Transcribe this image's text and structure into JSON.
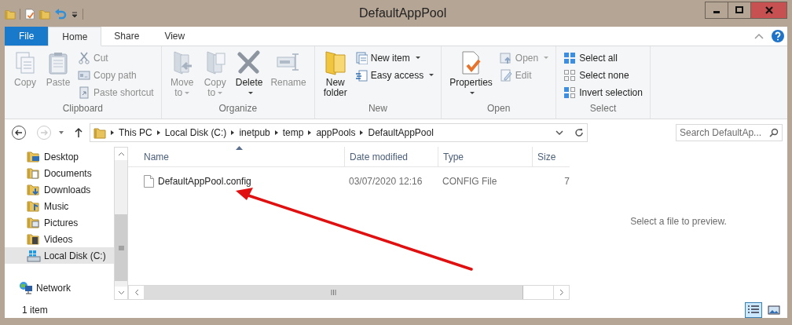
{
  "window": {
    "title": "DefaultAppPool"
  },
  "ribbon_tabs": [
    {
      "label": "File",
      "kind": "file",
      "selected": false
    },
    {
      "label": "Home",
      "kind": "tab",
      "selected": true
    },
    {
      "label": "Share",
      "kind": "tab",
      "selected": false
    },
    {
      "label": "View",
      "kind": "tab",
      "selected": false
    }
  ],
  "ribbon_groups": [
    {
      "label": "Clipboard",
      "items": [
        {
          "label": "Copy",
          "kind": "large",
          "disabled": true,
          "dropdown": false
        },
        {
          "label": "Paste",
          "kind": "large",
          "disabled": true,
          "dropdown": false
        },
        {
          "label": "Cut",
          "kind": "small",
          "disabled": true,
          "dropdown": false
        },
        {
          "label": "Copy path",
          "kind": "small",
          "disabled": true,
          "dropdown": false
        },
        {
          "label": "Paste shortcut",
          "kind": "small",
          "disabled": true,
          "dropdown": false
        }
      ]
    },
    {
      "label": "Organize",
      "items": [
        {
          "label": "Move to",
          "kind": "large",
          "disabled": true,
          "dropdown": true
        },
        {
          "label": "Copy to",
          "kind": "large",
          "disabled": true,
          "dropdown": true
        },
        {
          "label": "Delete",
          "kind": "large",
          "disabled": false,
          "dropdown": true
        },
        {
          "label": "Rename",
          "kind": "large",
          "disabled": true,
          "dropdown": false
        }
      ]
    },
    {
      "label": "New",
      "items": [
        {
          "label": "New folder",
          "kind": "large",
          "disabled": false,
          "dropdown": false
        },
        {
          "label": "New item",
          "kind": "small",
          "disabled": false,
          "dropdown": true
        },
        {
          "label": "Easy access",
          "kind": "small",
          "disabled": false,
          "dropdown": true
        }
      ]
    },
    {
      "label": "Open",
      "items": [
        {
          "label": "Properties",
          "kind": "large",
          "disabled": false,
          "dropdown": true
        },
        {
          "label": "Open",
          "kind": "small",
          "disabled": true,
          "dropdown": true
        },
        {
          "label": "Edit",
          "kind": "small",
          "disabled": true,
          "dropdown": false
        }
      ]
    },
    {
      "label": "Select",
      "items": [
        {
          "label": "Select all",
          "kind": "small",
          "disabled": false,
          "dropdown": false
        },
        {
          "label": "Select none",
          "kind": "small",
          "disabled": false,
          "dropdown": false
        },
        {
          "label": "Invert selection",
          "kind": "small",
          "disabled": false,
          "dropdown": false
        }
      ]
    }
  ],
  "address": {
    "crumbs": [
      "This PC",
      "Local Disk (C:)",
      "inetpub",
      "temp",
      "appPools",
      "DefaultAppPool"
    ]
  },
  "search": {
    "placeholder": "Search DefaultAp..."
  },
  "nav": {
    "items": [
      {
        "label": "Desktop",
        "selected": false
      },
      {
        "label": "Documents",
        "selected": false
      },
      {
        "label": "Downloads",
        "selected": false
      },
      {
        "label": "Music",
        "selected": false
      },
      {
        "label": "Pictures",
        "selected": false
      },
      {
        "label": "Videos",
        "selected": false
      },
      {
        "label": "Local Disk (C:)",
        "selected": true
      }
    ],
    "network": {
      "label": "Network",
      "selected": false
    }
  },
  "table": {
    "columns": [
      "Name",
      "Date modified",
      "Type",
      "Size"
    ],
    "rows": [
      {
        "name": "DefaultAppPool.config",
        "date_modified": "03/07/2020 12:16",
        "type": "CONFIG File",
        "size": "7",
        "selected": false
      }
    ]
  },
  "preview": {
    "message": "Select a file to preview."
  },
  "status_bar": {
    "item_count": "1 item",
    "views": [
      {
        "kind": "details",
        "selected": true
      },
      {
        "kind": "large_icons",
        "selected": false
      }
    ]
  }
}
